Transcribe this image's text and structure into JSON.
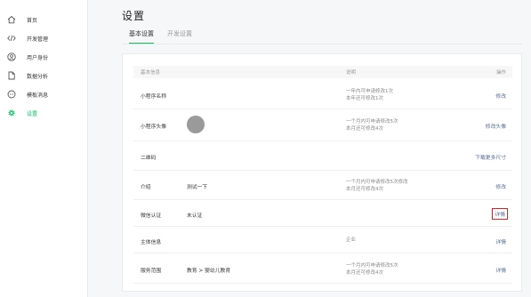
{
  "sidebar": {
    "items": [
      {
        "label": "首页",
        "icon": "home-icon"
      },
      {
        "label": "开发管理",
        "icon": "code-icon"
      },
      {
        "label": "用户身份",
        "icon": "user-icon"
      },
      {
        "label": "数据分析",
        "icon": "document-icon"
      },
      {
        "label": "模板消息",
        "icon": "message-icon"
      },
      {
        "label": "设置",
        "icon": "gear-icon",
        "active": true
      }
    ]
  },
  "main": {
    "title": "设置",
    "tabs": [
      {
        "label": "基本设置",
        "active": true
      },
      {
        "label": "开发设置",
        "active": false
      }
    ],
    "table": {
      "headers": {
        "name": "基本信息",
        "desc": "说明",
        "op": "操作"
      },
      "rows": [
        {
          "name": "小程序名称",
          "value": "",
          "desc": [
            "一年内可申请修改1次",
            "本年还可修改1次"
          ],
          "op": "修改"
        },
        {
          "name": "小程序头像",
          "value": "",
          "desc": [
            "一个月内可申请修改5次",
            "本月还可修改4次"
          ],
          "op": "修改头像"
        },
        {
          "name": "二维码",
          "value": "",
          "desc": [],
          "op": "下载更多尺寸"
        },
        {
          "name": "介绍",
          "value": "测试一下",
          "desc": [
            "一个月内可申请修改5次修改",
            "本月还可修改4次"
          ],
          "op": "修改"
        },
        {
          "name": "微信认证",
          "value": "未认证",
          "desc": [],
          "op": "详情"
        },
        {
          "name": "主体信息",
          "value": "",
          "desc": [
            "企业"
          ],
          "op": "详情"
        },
        {
          "name": "服务范围",
          "value": "教育 > 婴幼儿教育",
          "desc": [
            "一个月内可申请修改5次",
            "本月还可修改4次"
          ],
          "op": "详情"
        }
      ]
    }
  },
  "colors": {
    "accent": "#07c160",
    "link": "#576b95",
    "highlight": "#e02020"
  }
}
